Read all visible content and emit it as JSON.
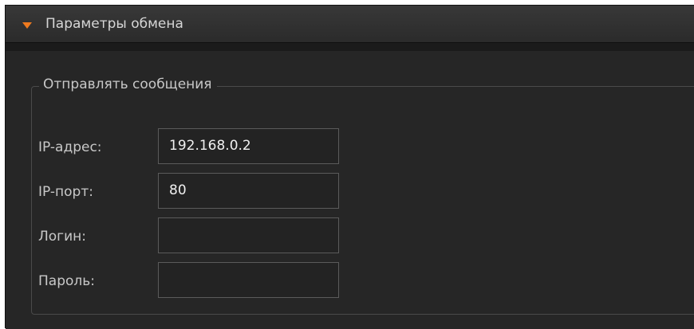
{
  "panel": {
    "title": "Параметры обмена",
    "expanded_icon": "triangle-down-icon",
    "accent_color": "#ee7a1f"
  },
  "send_group": {
    "title": "Отправлять сообщения",
    "fields": [
      {
        "label": "IP-адрес:",
        "value": "192.168.0.2"
      },
      {
        "label": "IP-порт:",
        "value": "80"
      },
      {
        "label": "Логин:",
        "value": ""
      },
      {
        "label": "Пароль:",
        "value": ""
      }
    ]
  }
}
